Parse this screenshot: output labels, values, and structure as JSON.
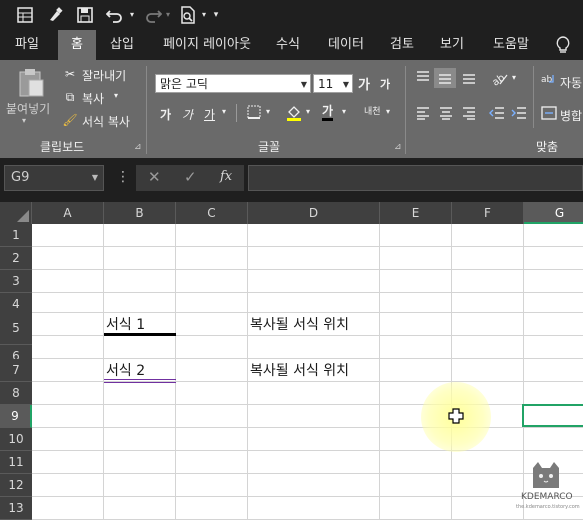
{
  "toolbar": {
    "qat_icons": [
      "table-icon",
      "brush-icon",
      "save-icon",
      "undo-icon",
      "redo-icon",
      "print-preview-icon",
      "customize-icon"
    ]
  },
  "tabs": [
    {
      "label": "파일"
    },
    {
      "label": "홈"
    },
    {
      "label": "삽입"
    },
    {
      "label": "페이지 레이아웃"
    },
    {
      "label": "수식"
    },
    {
      "label": "데이터"
    },
    {
      "label": "검토"
    },
    {
      "label": "보기"
    },
    {
      "label": "도움말"
    }
  ],
  "ribbon": {
    "paste_label": "붙여넣기",
    "cut_label": "잘라내기",
    "copy_label": "복사",
    "format_painter_label": "서식 복사",
    "clipboard_group": "클립보드",
    "font_name": "맑은 고딕",
    "font_size": "11",
    "font_group": "글꼴",
    "bold_glyph": "가",
    "italic_glyph": "가",
    "underline_glyph": "가",
    "grow_glyph": "가",
    "shrink_glyph": "가",
    "fontcolor_glyph": "가",
    "phonetic_glyph": "내천",
    "wrap_label": "자동",
    "merge_label": "병합",
    "align_group": "맞춤"
  },
  "formula_bar": {
    "name_box": "G9",
    "cancel_glyph": "✕",
    "enter_glyph": "✓",
    "fx_glyph": "fx",
    "value": ""
  },
  "sheet": {
    "columns": [
      "A",
      "B",
      "C",
      "D",
      "E",
      "F",
      "G"
    ],
    "rows": [
      "1",
      "2",
      "3",
      "4",
      "5",
      "6",
      "7",
      "8",
      "9",
      "10",
      "11",
      "12",
      "13"
    ],
    "selected_cell": "G9",
    "cells": {
      "B5": "서식 1",
      "D5": "복사될 서식 위치",
      "B7": "서식 2",
      "D7": "복사될 서식 위치"
    }
  },
  "watermark": {
    "name": "KDEMARCO",
    "url": "the.kdemarco.tistory.com"
  }
}
